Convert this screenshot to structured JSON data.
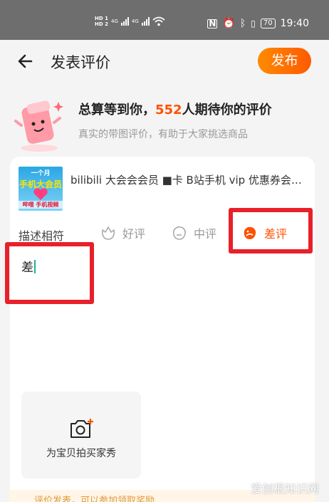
{
  "status_bar": {
    "sim1": "HD 1",
    "sim2": "HD 2",
    "net1": "4G",
    "net2": "4G",
    "battery": "70",
    "time": "19:40"
  },
  "header": {
    "title": "发表评价",
    "publish_label": "发布"
  },
  "promo": {
    "prefix": "总算等到你，",
    "count": "552",
    "suffix": "人期待你的评价",
    "subtitle": "真实的带图评价，有助于大家挑选商品"
  },
  "product": {
    "thumb_top": "一个月",
    "thumb_mid": "手机大会员",
    "thumb_bottom": "哔哩 手机视频",
    "title": "bilibili 大会会会员 ■卡 B站手机 vip 优惠券会员卡"
  },
  "rating": {
    "label": "描述相符",
    "options": [
      {
        "label": "好评",
        "icon": "flower-icon"
      },
      {
        "label": "中评",
        "icon": "neutral-face-icon"
      },
      {
        "label": "差评",
        "icon": "sad-face-icon"
      }
    ],
    "selected": "差评"
  },
  "review": {
    "text": "差"
  },
  "photo": {
    "label": "为宝贝拍买家秀"
  },
  "bottom": {
    "tip": "评价发表，可以参加领取奖励"
  },
  "watermark": "爱刨根知识网",
  "colors": {
    "accent": "#ff5000",
    "highlight": "#e8202a",
    "caret": "#1ab394"
  }
}
